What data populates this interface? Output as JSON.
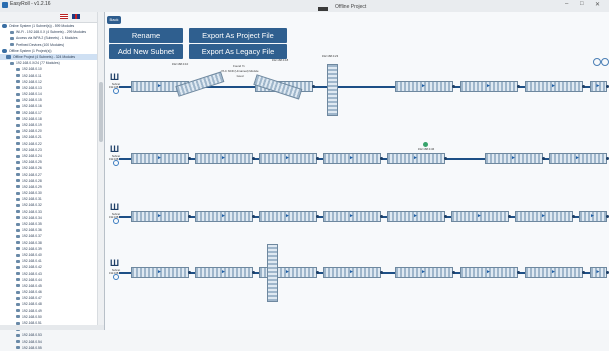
{
  "window": {
    "app_title": "EasyRoll - v1.2.16",
    "title": "Offline Project",
    "controls": [
      "–",
      "□",
      "✕"
    ]
  },
  "sidebar": {
    "tree": [
      {
        "label": "Online System (1 Subnet(s)) - 599 Modules",
        "kind": "net"
      },
      {
        "label": "Wi-Fi - 192.168.0.X (4 Subnets) - 299 Modules",
        "kind": "dev"
      },
      {
        "label": "Access via WPA 2 (Subnets) - 1 Modules",
        "kind": "dev"
      },
      {
        "label": "Prefixed Devices (100 Modules)",
        "kind": "dev"
      },
      {
        "label": "Offline System (1 Project(s))",
        "kind": "net"
      },
      {
        "label": "Offline Project (4 Subnets) - 324 Modules",
        "kind": "sel"
      },
      {
        "label": "192.168.0.X/24 (77 Modules)",
        "kind": "dev"
      }
    ],
    "ips": [
      "192.168.0.10",
      "192.168.0.11",
      "192.168.0.12",
      "192.168.0.13",
      "192.168.0.14",
      "192.168.0.15",
      "192.168.0.16",
      "192.168.0.17",
      "192.168.0.18",
      "192.168.0.19",
      "192.168.0.20",
      "192.168.0.21",
      "192.168.0.22",
      "192.168.0.23",
      "192.168.0.24",
      "192.168.0.25",
      "192.168.0.26",
      "192.168.0.27",
      "192.168.0.28",
      "192.168.0.29",
      "192.168.0.30",
      "192.168.0.31",
      "192.168.0.32",
      "192.168.0.33",
      "192.168.0.34",
      "192.168.0.35",
      "192.168.0.36",
      "192.168.0.37",
      "192.168.0.38",
      "192.168.0.39",
      "192.168.0.40",
      "192.168.0.41",
      "192.168.0.42",
      "192.168.0.43",
      "192.168.0.44",
      "192.168.0.45",
      "192.168.0.46",
      "192.168.0.47",
      "192.168.0.48",
      "192.168.0.49",
      "192.168.0.50",
      "192.168.0.51",
      "192.168.0.52",
      "192.168.0.53",
      "192.168.0.54",
      "192.168.0.55"
    ]
  },
  "toolbar": {
    "back_label": "Back",
    "rename_label": "Rename",
    "export_project_label": "Export As Project File",
    "add_subnet_label": "Add New Subnet",
    "export_legacy_label": "Export As Legacy File"
  },
  "subnets": [
    {
      "label": "Subnet 192.168.0.X"
    },
    {
      "label": "Subnet 192.168.1.X"
    },
    {
      "label": "Subnet 192.168.2.X"
    },
    {
      "label": "Subnet 192.168.3.X"
    }
  ],
  "annotations": {
    "pvc_label": "Found 7x",
    "pvc_sub": "PLC NCD (Unnamed) Module",
    "pvc_state": "Good",
    "ip_a": "192.168.0.10",
    "ip_b": "192.168.0.18",
    "ip_c": "192.168.0.23",
    "ip_d": "192.168.0.46"
  },
  "colors": {
    "accent": "#2f5f8f",
    "line": "#1d4f86"
  }
}
